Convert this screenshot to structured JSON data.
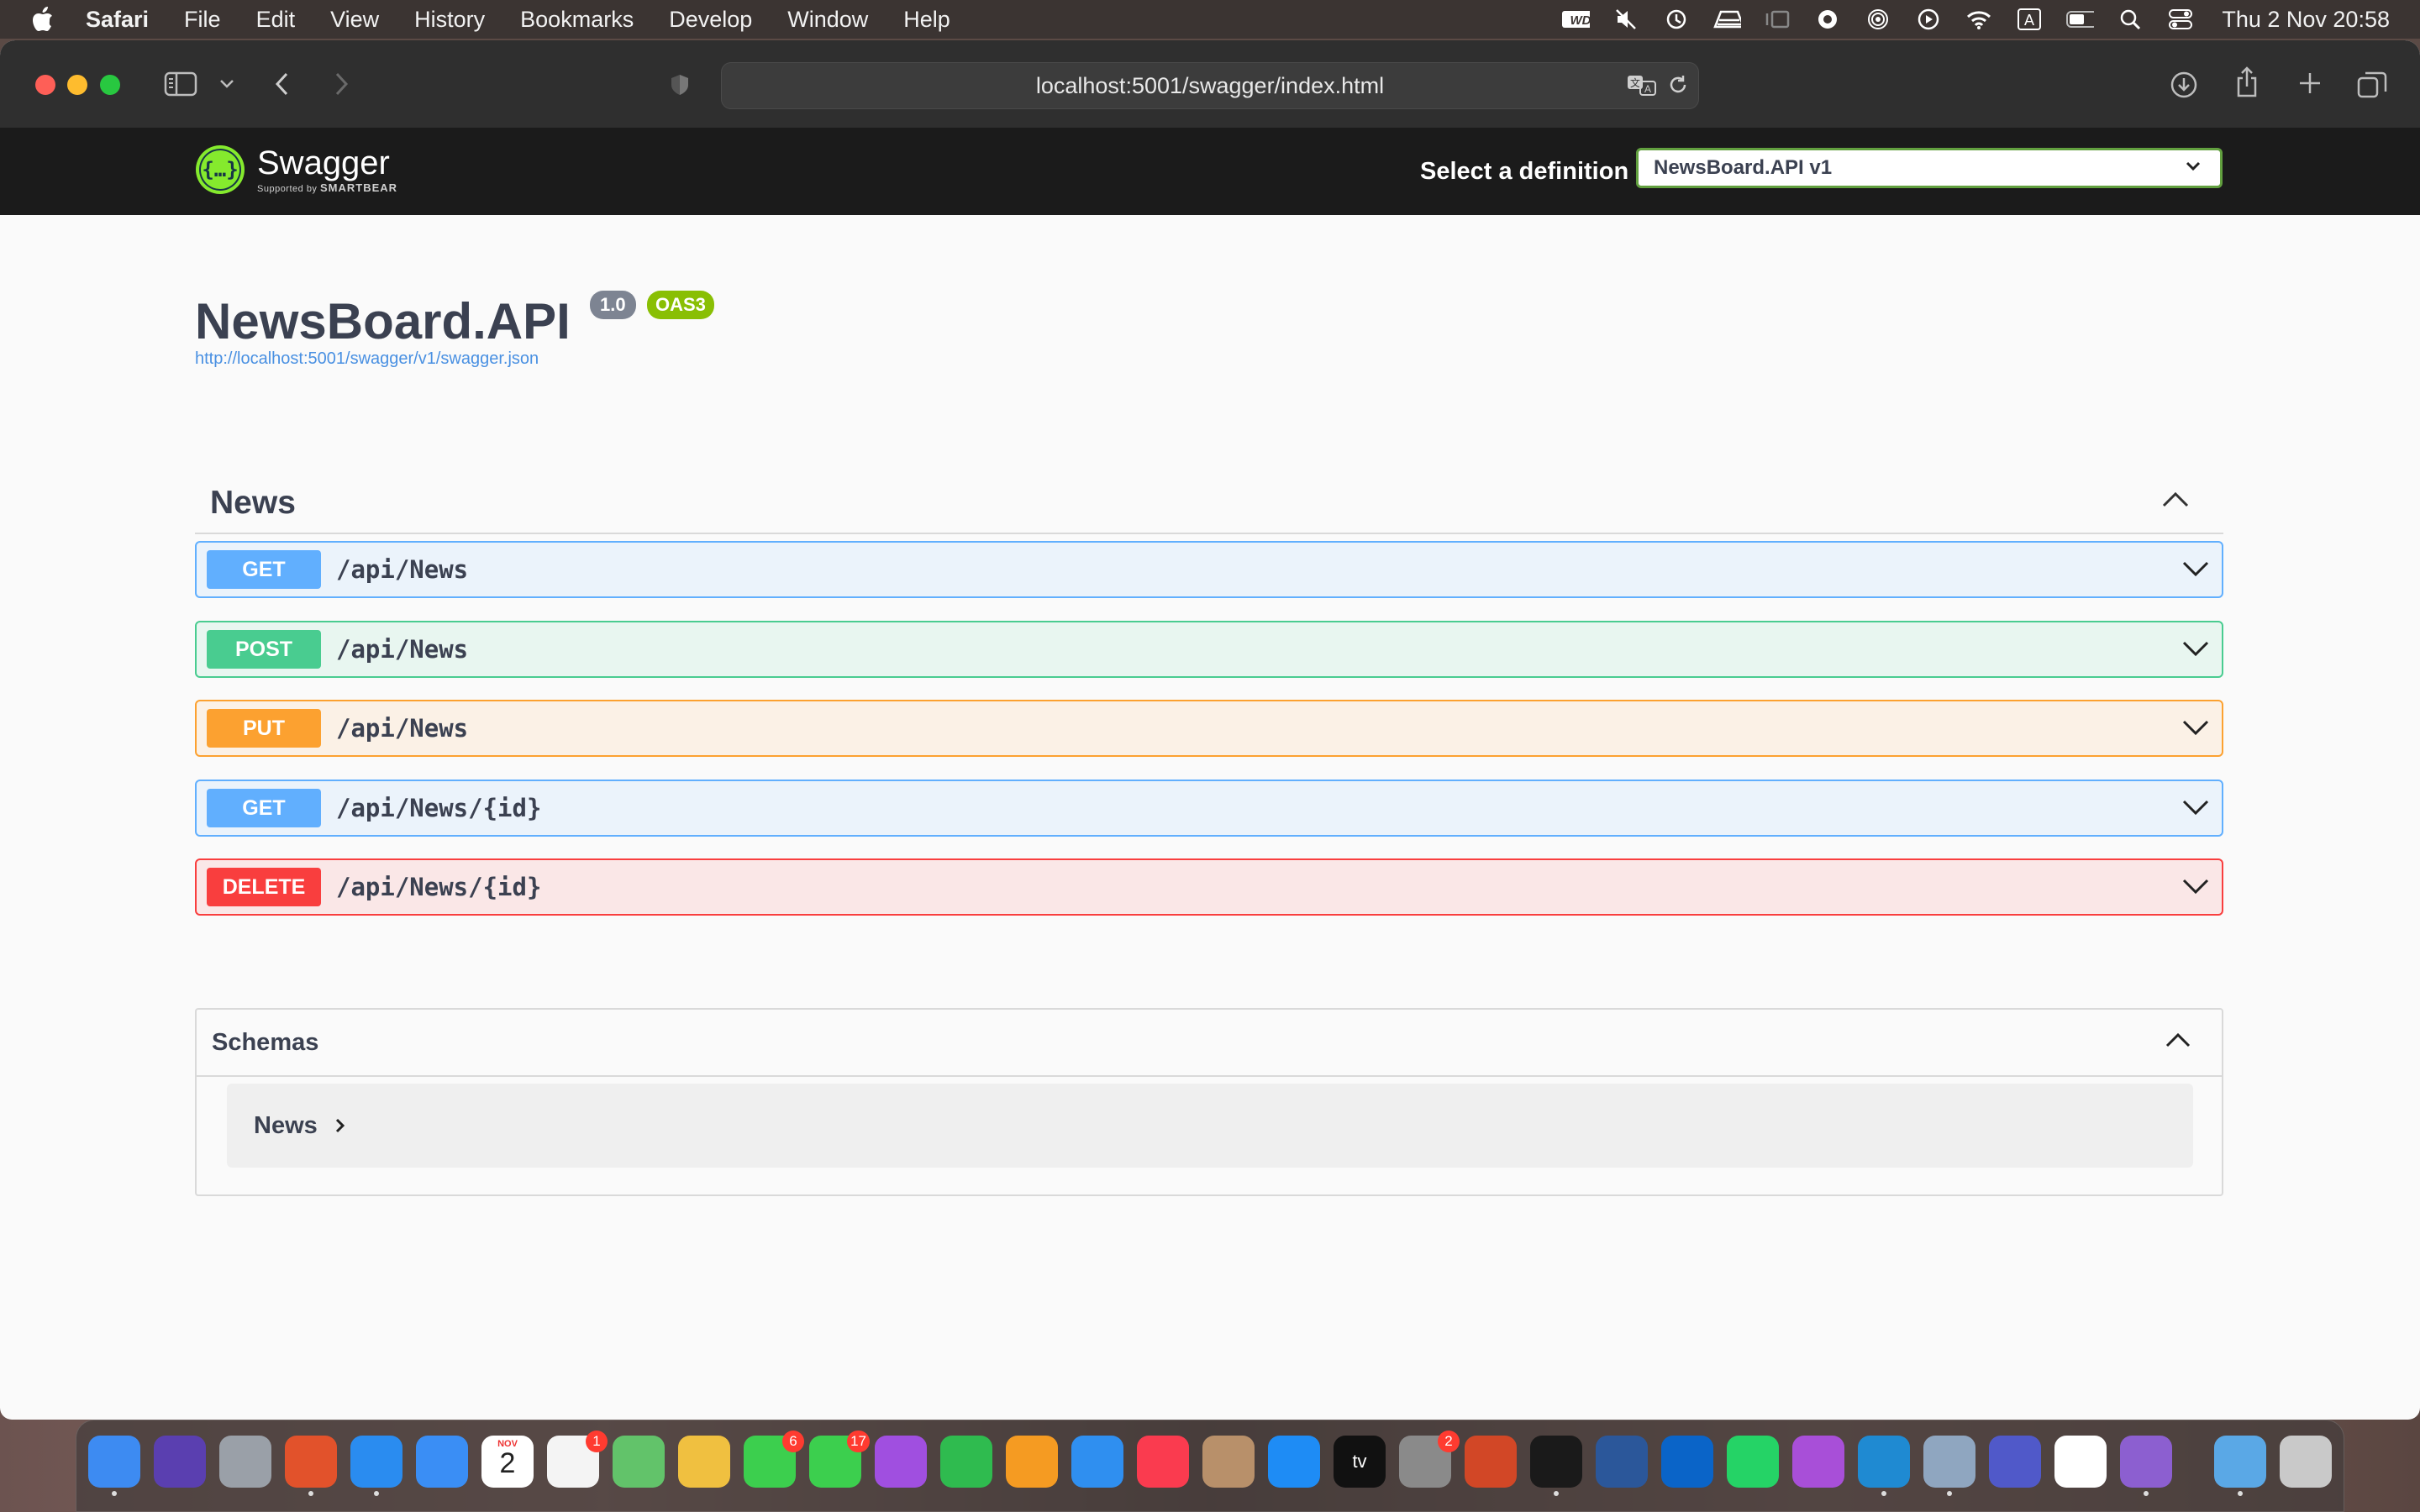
{
  "menubar": {
    "app": "Safari",
    "items": [
      "File",
      "Edit",
      "View",
      "History",
      "Bookmarks",
      "Develop",
      "Window",
      "Help"
    ],
    "clock": "Thu 2 Nov  20:58",
    "status_icons": [
      "wd-icon",
      "mute-icon",
      "time-machine-icon",
      "menu-icon",
      "stage-manager-icon",
      "focus-icon",
      "airdrop-icon",
      "play-icon",
      "wifi-icon",
      "input-source-icon",
      "battery-icon",
      "spotlight-icon",
      "control-center-icon"
    ],
    "input_source": "A"
  },
  "browser": {
    "url": "localhost:5001/swagger/index.html"
  },
  "swagger": {
    "logo_name": "Swagger",
    "logo_sub": "Supported by",
    "logo_brand": "SMARTBEAR",
    "select_label": "Select a definition",
    "selected_definition": "NewsBoard.API v1"
  },
  "api": {
    "title": "NewsBoard.API",
    "version": "1.0",
    "oas": "OAS3",
    "spec_url": "http://localhost:5001/swagger/v1/swagger.json"
  },
  "tag": {
    "name": "News",
    "operations": [
      {
        "method": "GET",
        "path": "/api/News"
      },
      {
        "method": "POST",
        "path": "/api/News"
      },
      {
        "method": "PUT",
        "path": "/api/News"
      },
      {
        "method": "GET",
        "path": "/api/News/{id}"
      },
      {
        "method": "DELETE",
        "path": "/api/News/{id}"
      }
    ]
  },
  "schemas": {
    "title": "Schemas",
    "models": [
      "News"
    ]
  },
  "dock": {
    "apps": [
      {
        "name": "finder",
        "color": "#3d8bf2"
      },
      {
        "name": "siri",
        "color": "#5a3fb0"
      },
      {
        "name": "launchpad",
        "color": "#9aa0a8"
      },
      {
        "name": "firefox",
        "color": "#e2522b"
      },
      {
        "name": "safari",
        "color": "#2a8cf0"
      },
      {
        "name": "mail",
        "color": "#3a8ef5"
      },
      {
        "name": "calendar",
        "color": "#ffffff",
        "label": "2",
        "month": "NOV"
      },
      {
        "name": "reminders",
        "color": "#f4f4f4",
        "badge": "1"
      },
      {
        "name": "maps",
        "color": "#62c36a"
      },
      {
        "name": "photos",
        "color": "#f0c040"
      },
      {
        "name": "facetime",
        "color": "#3ccf4e",
        "badge": "6"
      },
      {
        "name": "messages",
        "color": "#3ccf4e",
        "badge": "17"
      },
      {
        "name": "podcasts",
        "color": "#a04fe0"
      },
      {
        "name": "numbers",
        "color": "#2fbb4f"
      },
      {
        "name": "pages",
        "color": "#f59b22"
      },
      {
        "name": "keynote",
        "color": "#2f8ff0"
      },
      {
        "name": "music",
        "color": "#fa3b4f"
      },
      {
        "name": "contacts",
        "color": "#b8906a"
      },
      {
        "name": "app-store",
        "color": "#1e8cf5"
      },
      {
        "name": "apple-tv",
        "color": "#111111",
        "label": "tv"
      },
      {
        "name": "system-settings",
        "color": "#8a8a8a",
        "badge": "2"
      },
      {
        "name": "powerpoint",
        "color": "#d24726"
      },
      {
        "name": "terminal",
        "color": "#1a1a1a"
      },
      {
        "name": "word",
        "color": "#2b579a"
      },
      {
        "name": "outlook",
        "color": "#0a64c8"
      },
      {
        "name": "whatsapp",
        "color": "#25d366"
      },
      {
        "name": "feedback",
        "color": "#a84fd8"
      },
      {
        "name": "vscode",
        "color": "#1f8ad2"
      },
      {
        "name": "preview",
        "color": "#8fa6c0"
      },
      {
        "name": "teams",
        "color": "#5059c9"
      },
      {
        "name": "mongodb-compass",
        "color": "#ffffff"
      },
      {
        "name": "visual-studio",
        "color": "#8c5fd0"
      },
      {
        "name": "downloads-folder",
        "color": "#5aa8e6"
      },
      {
        "name": "trash",
        "color": "#c9c9c9"
      }
    ]
  }
}
